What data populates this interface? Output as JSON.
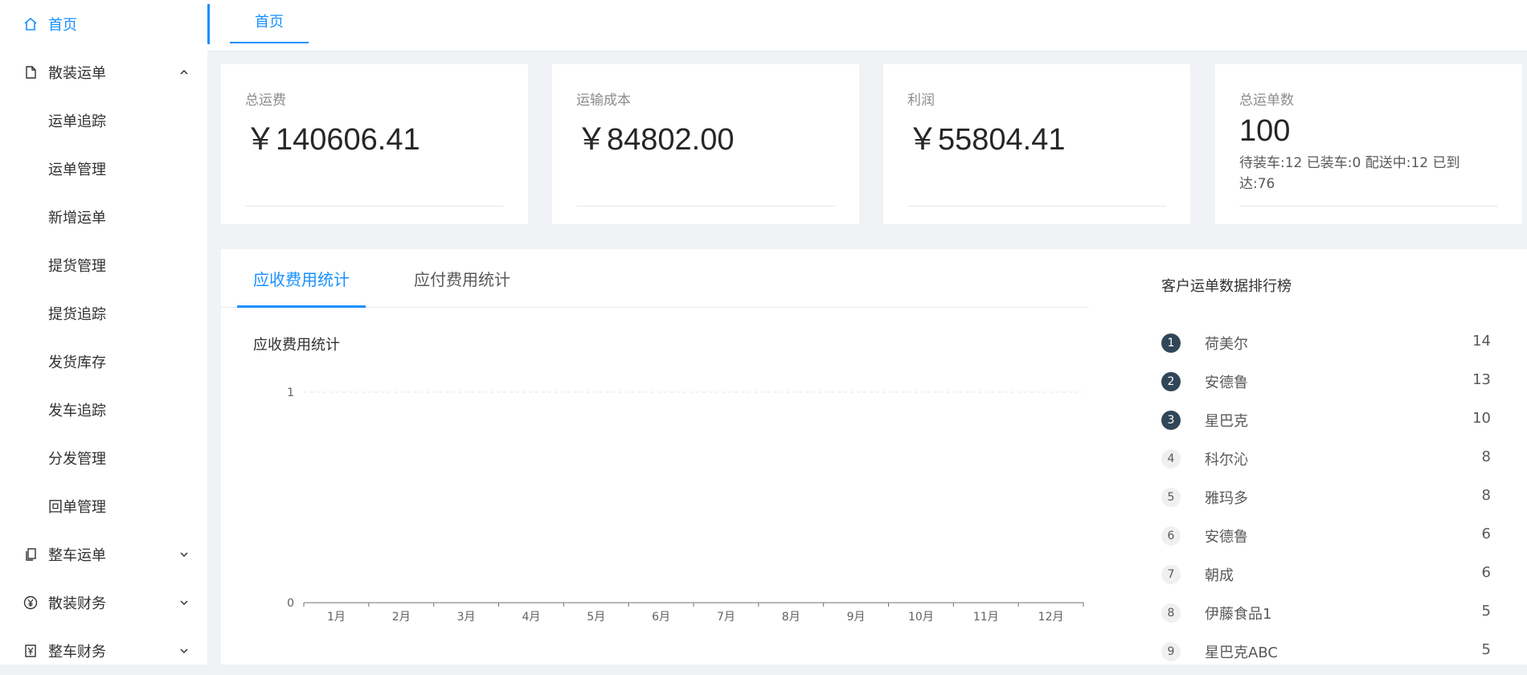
{
  "sidebar": {
    "items": [
      {
        "label": "首页",
        "icon": "home-icon",
        "active": true
      },
      {
        "label": "散装运单",
        "icon": "document-icon",
        "expanded": true,
        "children": [
          "运单追踪",
          "运单管理",
          "新增运单",
          "提货管理",
          "提货追踪",
          "发货库存",
          "发车追踪",
          "分发管理",
          "回单管理"
        ]
      },
      {
        "label": "整车运单",
        "icon": "copy-icon",
        "expanded": false
      },
      {
        "label": "散装财务",
        "icon": "yen-circle-icon",
        "expanded": false
      },
      {
        "label": "整车财务",
        "icon": "yen-doc-icon",
        "expanded": false
      }
    ]
  },
  "topbar": {
    "tab_label": "首页"
  },
  "stats": [
    {
      "title": "总运费",
      "value": "￥140606.41"
    },
    {
      "title": "运输成本",
      "value": "￥84802.00"
    },
    {
      "title": "利润",
      "value": "￥55804.41"
    },
    {
      "title": "总运单数",
      "value": "100",
      "extra": "待装车:12   已装车:0   配送中:12   已到达:76"
    }
  ],
  "panel": {
    "tabs": [
      "应收费用统计",
      "应付费用统计"
    ],
    "active_tab": 0,
    "chart_title": "应收费用统计",
    "ranking_title": "客户运单数据排行榜",
    "ranking": [
      {
        "rank": "1",
        "name": "荷美尔",
        "value": "14"
      },
      {
        "rank": "2",
        "name": "安德鲁",
        "value": "13"
      },
      {
        "rank": "3",
        "name": "星巴克",
        "value": "10"
      },
      {
        "rank": "4",
        "name": "科尔沁",
        "value": "8"
      },
      {
        "rank": "5",
        "name": "雅玛多",
        "value": "8"
      },
      {
        "rank": "6",
        "name": "安德鲁",
        "value": "6"
      },
      {
        "rank": "7",
        "name": "朝成",
        "value": "6"
      },
      {
        "rank": "8",
        "name": "伊藤食品1",
        "value": "5"
      },
      {
        "rank": "9",
        "name": "星巴克ABC",
        "value": "5"
      }
    ]
  },
  "chart_data": {
    "type": "line",
    "categories": [
      "1月",
      "2月",
      "3月",
      "4月",
      "5月",
      "6月",
      "7月",
      "8月",
      "9月",
      "10月",
      "11月",
      "12月"
    ],
    "series": [
      {
        "values": [
          0,
          0,
          0,
          0,
          0,
          0,
          0,
          0,
          0,
          0,
          0,
          0
        ]
      }
    ],
    "y_ticks": [
      "0",
      "1"
    ],
    "ylim": [
      0,
      1
    ],
    "grid": true
  },
  "colors": {
    "accent": "#1890ff",
    "rank_top": "#314659"
  }
}
